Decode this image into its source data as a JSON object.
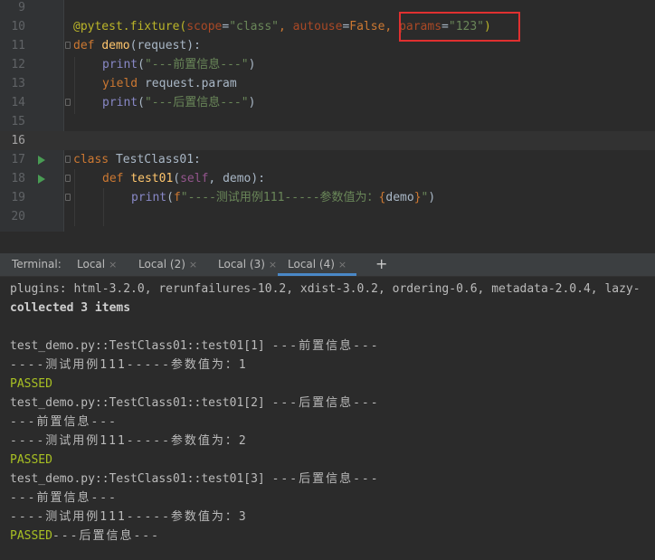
{
  "editor": {
    "line_numbers": [
      "9",
      "10",
      "11",
      "12",
      "13",
      "14",
      "15",
      "16",
      "17",
      "18",
      "19",
      "20"
    ],
    "lines": {
      "l10": {
        "deco": "@pytest.fixture(",
        "p_scope": "scope",
        "eq1": "=",
        "s_class": "\"class\"",
        "comma1": ", ",
        "p_autouse": "autouse",
        "eq2": "=",
        "kw_false": "False",
        "comma2": ", ",
        "p_params": "params",
        "eq3": "=",
        "s_params": "\"123\"",
        "close": ")"
      },
      "l11": {
        "kw": "def ",
        "fn": "demo",
        "rest": "(request):"
      },
      "l12": {
        "fn": "print",
        "open": "(",
        "str": "\"---前置信息---\"",
        "close": ")"
      },
      "l13": {
        "kw": "yield",
        "rest": " request.param"
      },
      "l14": {
        "fn": "print",
        "open": "(",
        "str": "\"---后置信息---\"",
        "close": ")"
      },
      "l17": {
        "kw": "class",
        "rest": " TestClass01:"
      },
      "l18": {
        "kw": "def ",
        "fn": "test01",
        "open": "(",
        "self": "self",
        "rest": ", demo):"
      },
      "l19": {
        "fn": "print",
        "open": "(",
        "f": "f",
        "str1": "\"----测试用例111-----参数值为：",
        "brace1": "{",
        "var": "demo",
        "brace2": "}",
        "str2": "\"",
        "close": ")"
      }
    }
  },
  "terminal": {
    "label": "Terminal:",
    "tabs": [
      {
        "title": "Local",
        "active": false
      },
      {
        "title": "Local (2)",
        "active": false
      },
      {
        "title": "Local (3)",
        "active": false
      },
      {
        "title": "Local (4)",
        "active": true
      }
    ],
    "close_glyph": "×",
    "add_glyph": "+",
    "output": {
      "plugins": "plugins: html-3.2.0, rerunfailures-10.2, xdist-3.0.2, ordering-0.6, metadata-2.0.4, lazy-",
      "collected": "collected 3 items",
      "t1": "test_demo.py::TestClass01::test01[1] ",
      "t1_info": "---前置信息---",
      "r1": "----测试用例111-----参数值为：1",
      "passed": "PASSED",
      "t2": "test_demo.py::TestClass01::test01[2] ",
      "t2_info": "---后置信息---",
      "pre2": "---前置信息---",
      "r2": "----测试用例111-----参数值为：2",
      "t3": "test_demo.py::TestClass01::test01[3] ",
      "t3_info": "---后置信息---",
      "pre3": "---前置信息---",
      "r3": "----测试用例111-----参数值为：3",
      "post3": "---后置信息---"
    }
  },
  "colors": {
    "keyword": "#cc7832",
    "string": "#6a8759",
    "function": "#ffc66d",
    "decorator": "#bbb529",
    "passed": "#a8c023",
    "highlight_box": "#e03030",
    "tab_underline": "#4a88c7"
  }
}
